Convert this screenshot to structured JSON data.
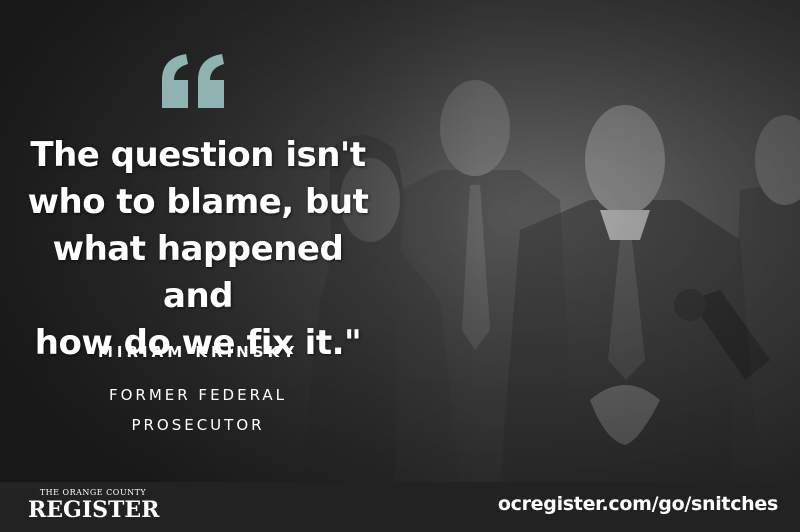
{
  "quote": {
    "mark_icon": "quotation-mark-icon",
    "mark_color": "#8fb3b0",
    "lines": [
      "The question isn't",
      "who to blame, but",
      "what happened and",
      "how do we fix it.\""
    ]
  },
  "speaker": {
    "name": "MIRIAM KRINSKY",
    "title_lines": [
      "FORMER FEDERAL",
      "PROSECUTOR"
    ]
  },
  "footer": {
    "brand_small": "THE ORANGE COUNTY",
    "brand_big": "REGISTER",
    "url": "ocregister.com/go/snitches"
  },
  "colors": {
    "footer_bg": "#222222",
    "text": "#ffffff",
    "quote_mark": "#8fb3b0"
  },
  "background": {
    "image_icon": "courtroom-sketch-image"
  }
}
